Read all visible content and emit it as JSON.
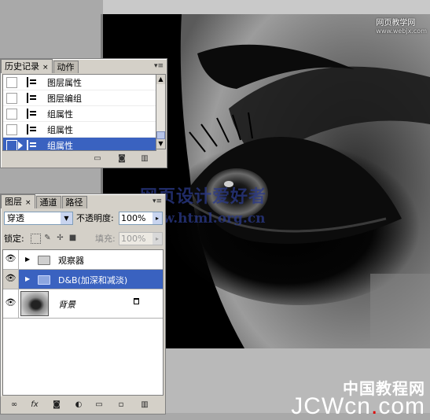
{
  "watermark": {
    "site_top_cn": "网页教学网",
    "site_top_en": "www.webjx.com",
    "center_line1": "网页设计爱好者",
    "center_line2": "www.html.org.cn",
    "bottom_cn": "中国教程网",
    "bottom_en_pre": "JCWcn",
    "bottom_en_dot": ".",
    "bottom_en_post": "com"
  },
  "history": {
    "tabs": [
      {
        "label": "历史记录",
        "close": "×"
      },
      {
        "label": "动作"
      }
    ],
    "menu": "▾≡",
    "items": [
      {
        "label": "图层属性"
      },
      {
        "label": "图层编组"
      },
      {
        "label": "组属性"
      },
      {
        "label": "组属性"
      },
      {
        "label": "组属性"
      }
    ],
    "selected_index": 4
  },
  "layers": {
    "tabs": [
      {
        "label": "图层",
        "close": "×"
      },
      {
        "label": "通道"
      },
      {
        "label": "路径"
      }
    ],
    "menu": "▾≡",
    "blend_mode": "穿透",
    "opacity_label": "不透明度:",
    "opacity_value": "100%",
    "lock_label": "锁定:",
    "fill_label": "填充:",
    "fill_value": "100%",
    "items": [
      {
        "name": "观察器",
        "type": "group",
        "expanded": false
      },
      {
        "name": "D&B(加深和减淡)",
        "type": "group",
        "expanded": false,
        "selected": true
      },
      {
        "name": "背景",
        "type": "background",
        "locked": true
      }
    ]
  },
  "colors": {
    "selection": "#3a62c0",
    "panel": "#d4d0c8",
    "workspace": "#a9a9a9"
  }
}
